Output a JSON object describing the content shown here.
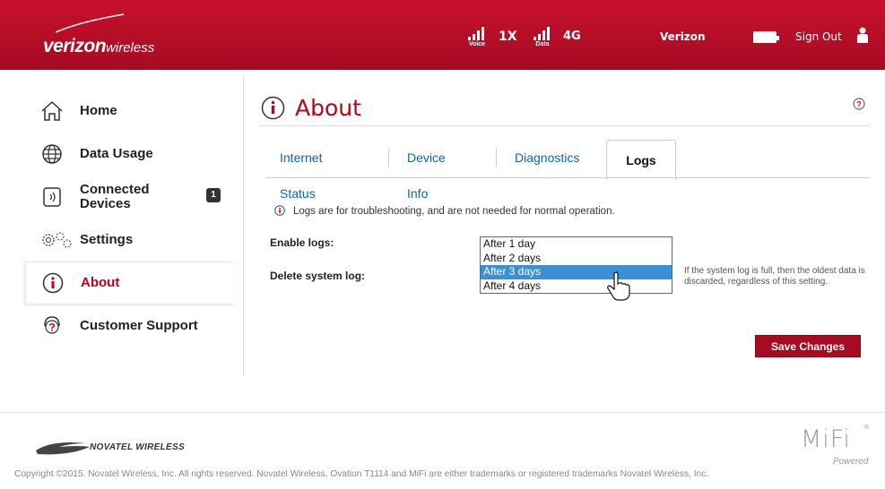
{
  "header": {
    "brand": "verizon",
    "brand_suffix": "wireless",
    "signal_voice_label": "Voice",
    "tech_voice": "1X",
    "signal_data_label": "Data",
    "tech_data": "4G",
    "carrier": "Verizon",
    "sign_out": "Sign Out"
  },
  "sidebar": {
    "items": [
      {
        "label": "Home",
        "icon": "home-icon"
      },
      {
        "label": "Data Usage",
        "icon": "globe-icon"
      },
      {
        "label": "Connected Devices",
        "icon": "device-icon",
        "badge": "1"
      },
      {
        "label": "Settings",
        "icon": "gears-icon"
      },
      {
        "label": "About",
        "icon": "info-icon",
        "active": true
      },
      {
        "label": "Customer Support",
        "icon": "support-icon"
      }
    ]
  },
  "main": {
    "title": "About",
    "tabs": [
      {
        "label": "Internet Status"
      },
      {
        "label": "Device Info"
      },
      {
        "label": "Diagnostics"
      },
      {
        "label": "Logs",
        "active": true
      }
    ],
    "info_note": "Logs are for troubleshooting, and are not needed for normal operation.",
    "enable_logs_label": "Enable logs:",
    "delete_log_label": "Delete system log:",
    "delete_options": [
      "After 1 day",
      "After 2 days",
      "After 3 days",
      "After 4 days"
    ],
    "delete_selected": "After 3 days",
    "delete_help": "If the system log is full, then the oldest data is discarded, regardless of this setting.",
    "save_button": "Save Changes"
  },
  "footer": {
    "company": "NOVATEL WIRELESS",
    "copyright": "Copyright ©2015. Novatel Wireless, Inc. All rights reserved. Novatel Wireless, Ovation T1114 and MiFi are either trademarks or registered trademarks Novatel Wireless, Inc.",
    "product": "MiFi",
    "product_reg": "®",
    "product_tag": "Powered"
  },
  "colors": {
    "brand_red": "#b5041c",
    "header_red": "#c8102e",
    "link_blue": "#0f63a6",
    "selected_blue": "#3b8fd4"
  }
}
